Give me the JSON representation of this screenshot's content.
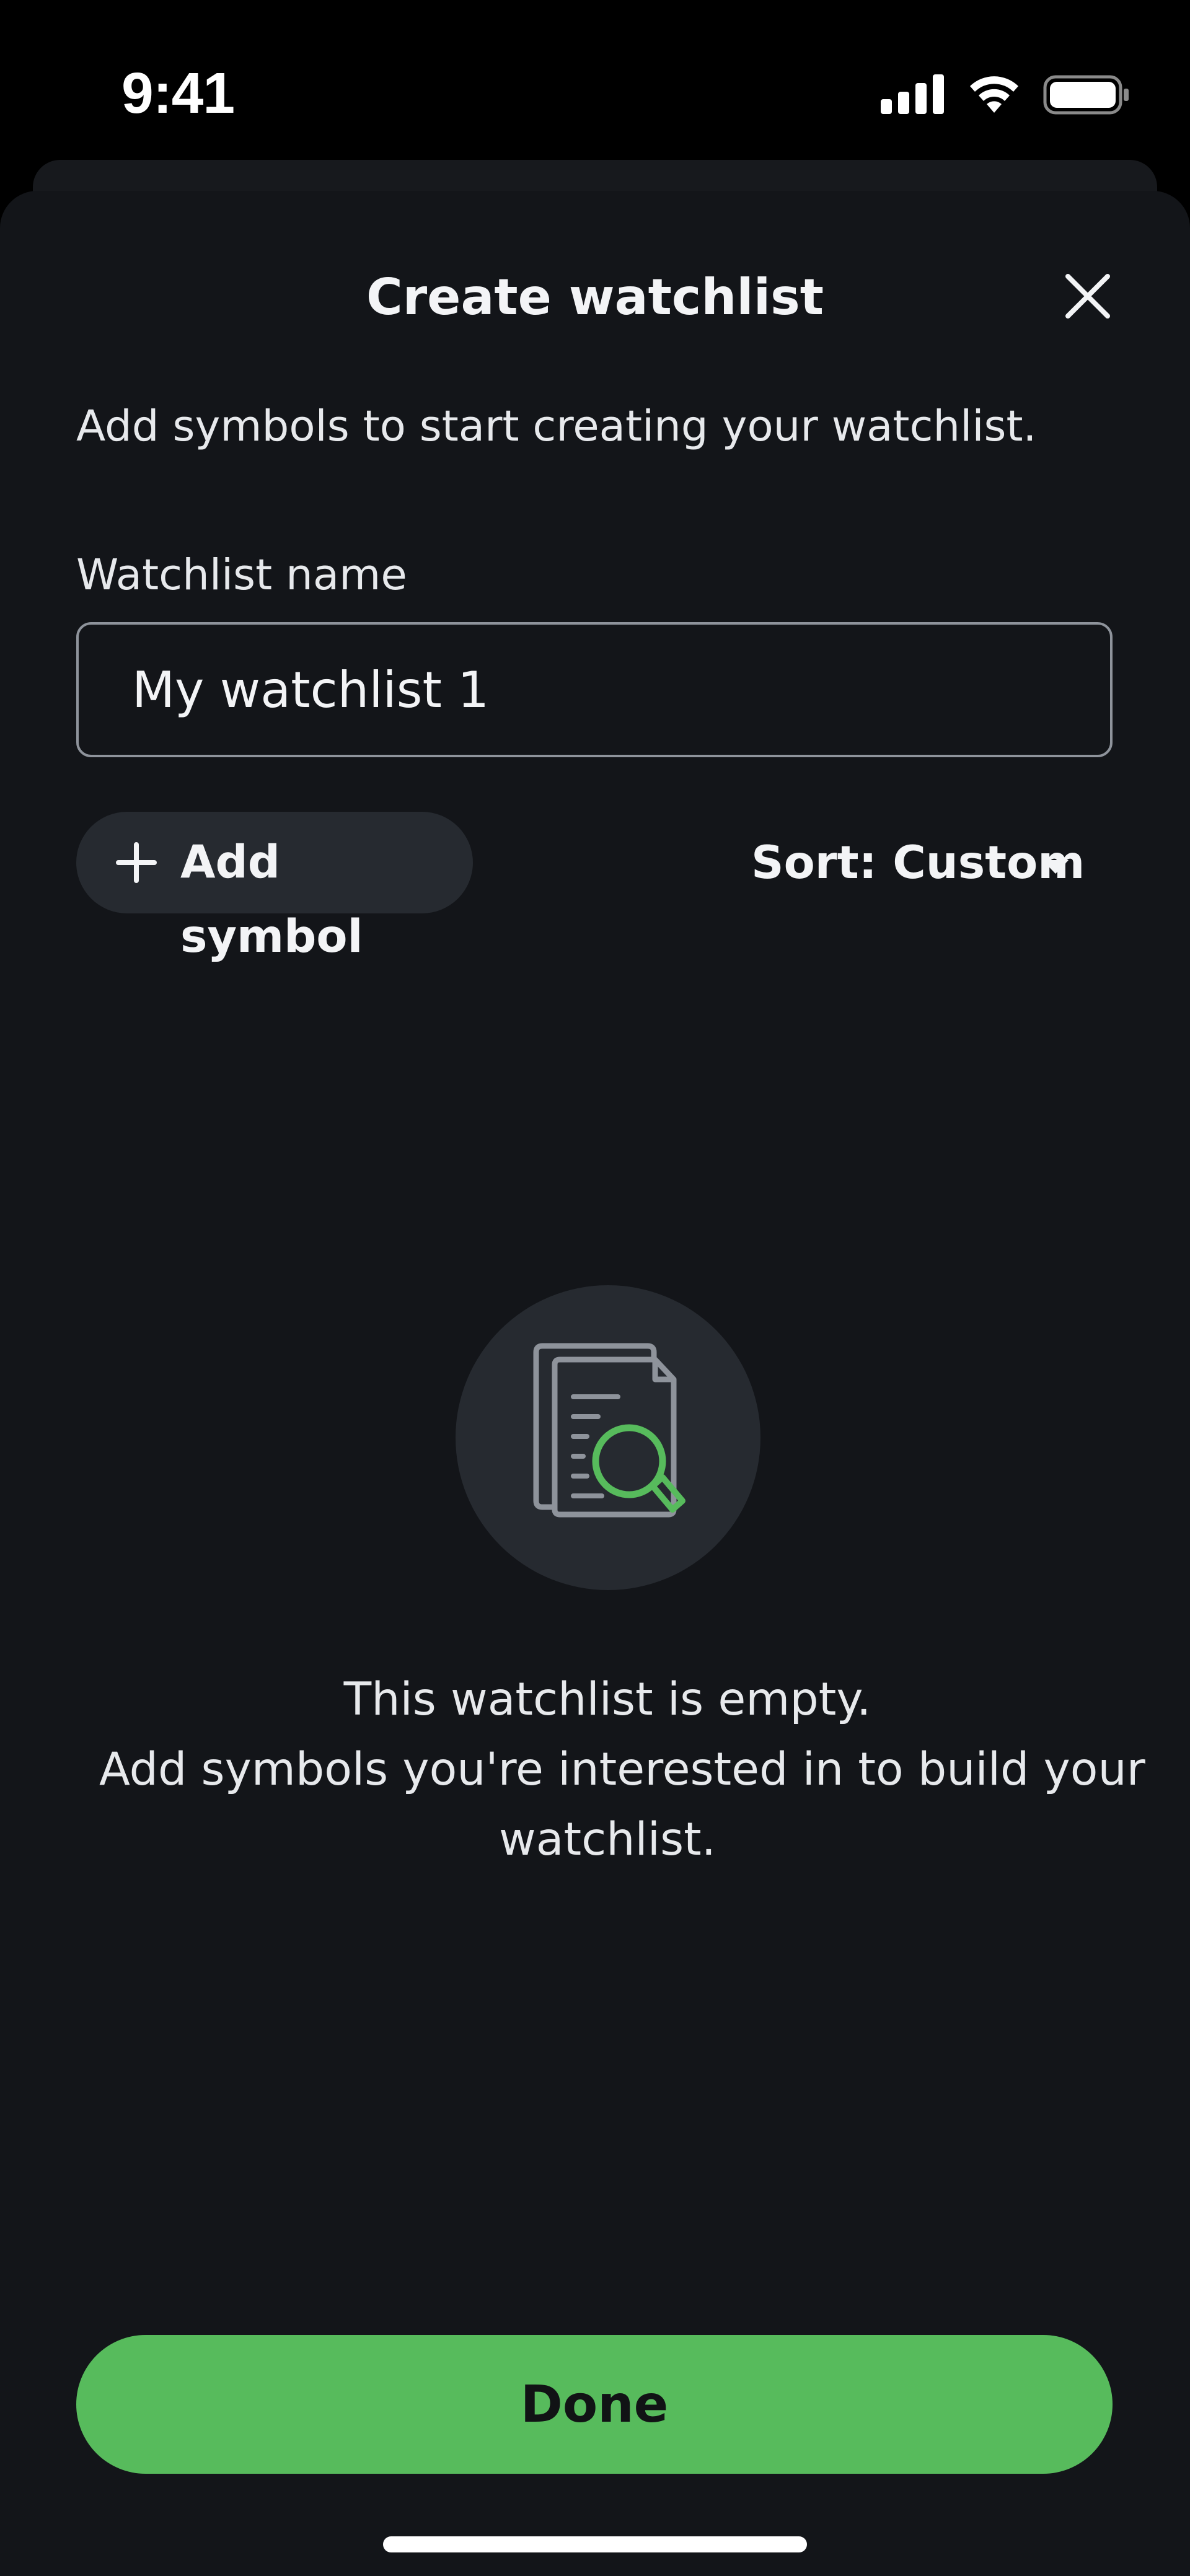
{
  "status_bar": {
    "time": "9:41",
    "icons": [
      "signal-icon",
      "wifi-icon",
      "battery-icon"
    ]
  },
  "sheet": {
    "title": "Create watchlist",
    "close_icon": "close-icon",
    "subtitle": "Add symbols to start creating your watchlist.",
    "name_field": {
      "label": "Watchlist name",
      "value": "My watchlist 1"
    },
    "add_symbol": {
      "icon": "plus-icon",
      "label": "Add symbol"
    },
    "sort": {
      "label": "Sort: Custom",
      "icon": "caret-down-icon"
    },
    "empty_state": {
      "icon": "document-search-icon",
      "line1": "This watchlist is empty.",
      "line2": "Add symbols you're interested in to build your",
      "line3": "watchlist."
    },
    "done_label": "Done"
  },
  "colors": {
    "background": "#131519",
    "accent": "#57bb5c",
    "surface": "#262a30",
    "text": "#f3f4f6"
  }
}
